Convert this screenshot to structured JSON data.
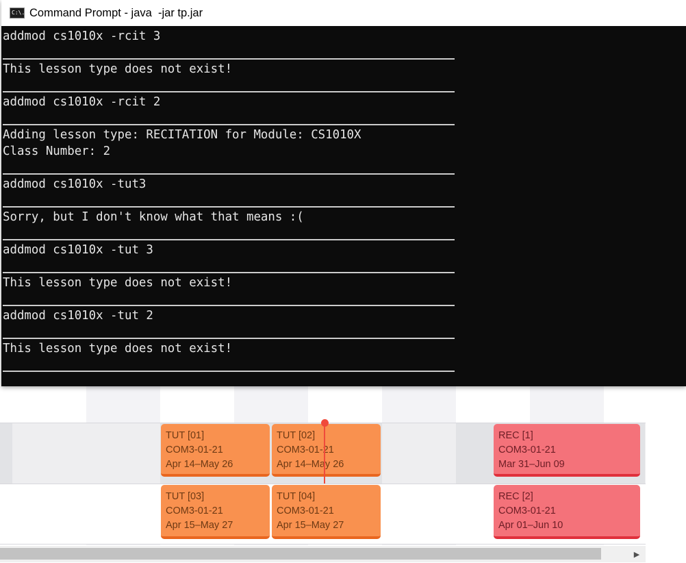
{
  "window": {
    "title": "Command Prompt - java  -jar tp.jar",
    "icon": "cmd-icon",
    "icon_glyph": "C:\\."
  },
  "console": {
    "lines": [
      "addmod cs1010x -rcit 3",
      "This lesson type does not exist!",
      "addmod cs1010x -rcit 2",
      "Adding lesson type: RECITATION for Module: CS1010X",
      "Class Number: 2",
      "addmod cs1010x -tut3",
      "Sorry, but I don't know what that means :(",
      "addmod cs1010x -tut 3",
      "This lesson type does not exist!",
      "addmod cs1010x -tut 2",
      "This lesson type does not exist!"
    ]
  },
  "timetable": {
    "lessons": [
      {
        "title": "TUT [01]",
        "venue": "COM3-01-21",
        "dates": "Apr 14–May 26",
        "type": "tutorial"
      },
      {
        "title": "TUT [02]",
        "venue": "COM3-01-21",
        "dates": "Apr 14–May 26",
        "type": "tutorial"
      },
      {
        "title": "REC [1]",
        "venue": "COM3-01-21",
        "dates": "Mar 31–Jun 09",
        "type": "recitation"
      },
      {
        "title": "TUT [03]",
        "venue": "COM3-01-21",
        "dates": "Apr 15–May 27",
        "type": "tutorial"
      },
      {
        "title": "TUT [04]",
        "venue": "COM3-01-21",
        "dates": "Apr 15–May 27",
        "type": "tutorial"
      },
      {
        "title": "REC [2]",
        "venue": "COM3-01-21",
        "dates": "Apr 01–Jun 10",
        "type": "recitation"
      }
    ],
    "colors": {
      "tutorial": "#f9914f",
      "tutorial_border": "#e9661f",
      "recitation": "#f4727a",
      "recitation_border": "#e0303c",
      "current_time": "#f04a3b"
    },
    "scroll_arrow_icon": "chevron-right-icon"
  }
}
